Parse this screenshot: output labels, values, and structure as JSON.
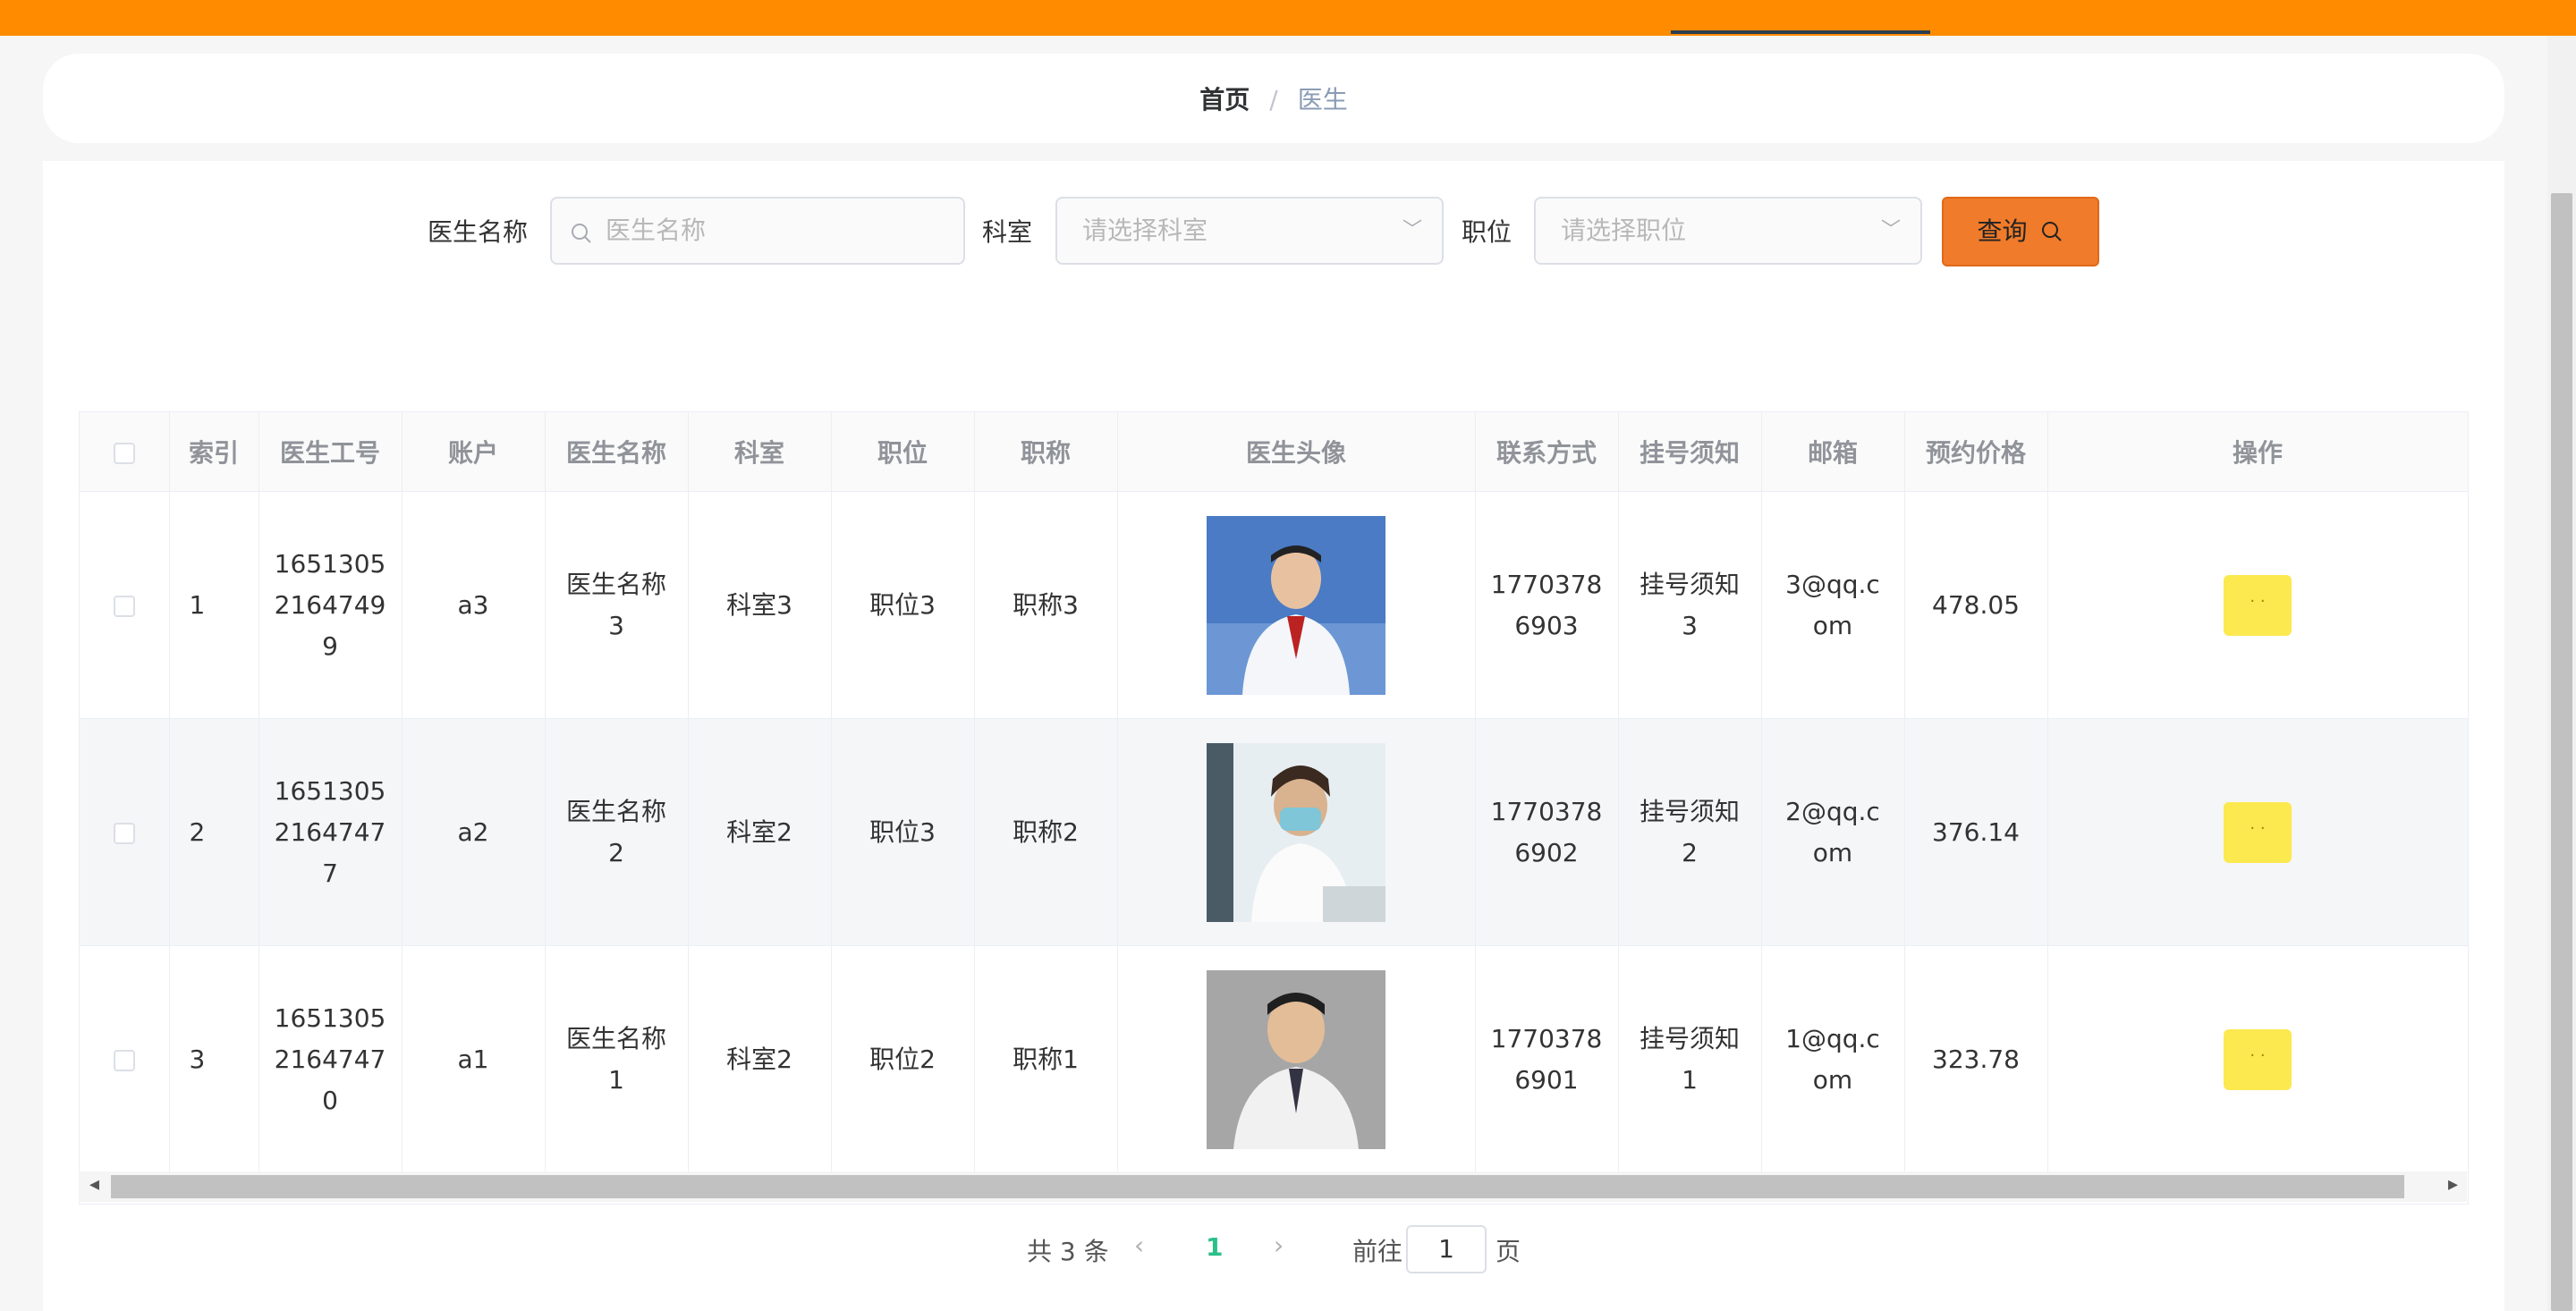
{
  "colors": {
    "topbar": "#ff8c00",
    "query_button": "#f07b2a",
    "op_button": "#fce94f",
    "current_page": "#2bbf8a"
  },
  "breadcrumb": {
    "home": "首页",
    "separator": "/",
    "current": "医生"
  },
  "search": {
    "name_label": "医生名称",
    "name_placeholder": "医生名称",
    "dept_label": "科室",
    "dept_placeholder": "请选择科室",
    "position_label": "职位",
    "position_placeholder": "请选择职位",
    "query_button": "查询"
  },
  "table": {
    "headers": [
      "索引",
      "医生工号",
      "账户",
      "医生名称",
      "科室",
      "职位",
      "职称",
      "医生头像",
      "联系方式",
      "挂号须知",
      "邮箱",
      "预约价格",
      "操作"
    ],
    "rows": [
      {
        "index": "1",
        "doctor_id": "16513052164749 9",
        "doctor_id_lines": [
          "1651305",
          "2164749",
          "9"
        ],
        "account": "a3",
        "name_lines": [
          "医生名称",
          "3"
        ],
        "dept": "科室3",
        "position": "职位3",
        "title": "职称3",
        "avatar": "doctor-photo-3",
        "phone_lines": [
          "1770378",
          "6903"
        ],
        "notice_lines": [
          "挂号须知",
          "3"
        ],
        "email_lines": [
          "3@qq.c",
          "om"
        ],
        "price": "478.05",
        "op": "· ·"
      },
      {
        "index": "2",
        "doctor_id_lines": [
          "1651305",
          "2164747",
          "7"
        ],
        "account": "a2",
        "name_lines": [
          "医生名称",
          "2"
        ],
        "dept": "科室2",
        "position": "职位3",
        "title": "职称2",
        "avatar": "doctor-photo-2",
        "phone_lines": [
          "1770378",
          "6902"
        ],
        "notice_lines": [
          "挂号须知",
          "2"
        ],
        "email_lines": [
          "2@qq.c",
          "om"
        ],
        "price": "376.14",
        "op": "· ·"
      },
      {
        "index": "3",
        "doctor_id_lines": [
          "1651305",
          "2164747",
          "0"
        ],
        "account": "a1",
        "name_lines": [
          "医生名称",
          "1"
        ],
        "dept": "科室2",
        "position": "职位2",
        "title": "职称1",
        "avatar": "doctor-photo-1",
        "phone_lines": [
          "1770378",
          "6901"
        ],
        "notice_lines": [
          "挂号须知",
          "1"
        ],
        "email_lines": [
          "1@qq.c",
          "om"
        ],
        "price": "323.78",
        "op": "· ·"
      }
    ]
  },
  "pagination": {
    "total": "共 3 条",
    "prev": "‹",
    "current": "1",
    "next": "›",
    "goto": "前往",
    "input": "1",
    "page_suffix": "页"
  }
}
